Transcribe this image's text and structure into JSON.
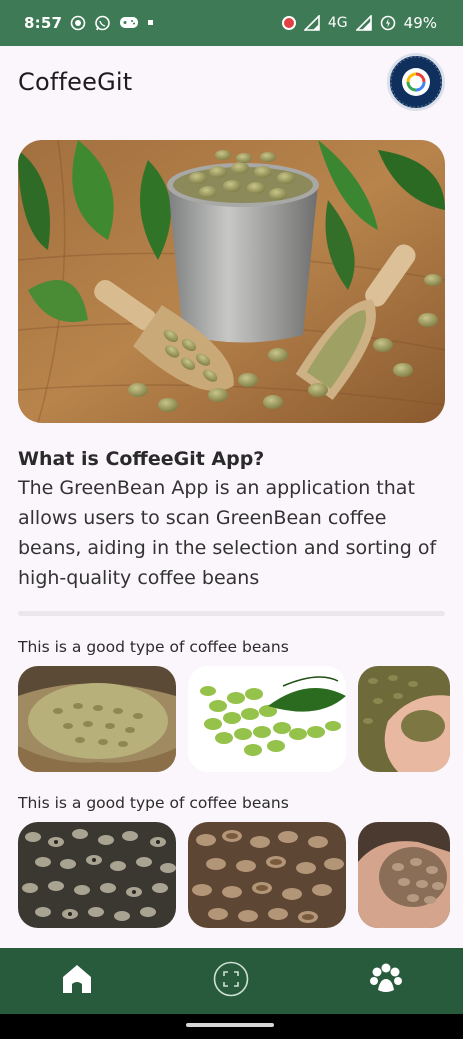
{
  "status_bar": {
    "time": "8:57",
    "network": "4G",
    "battery": "49%"
  },
  "app": {
    "title": "CoffeeGit",
    "avatar_icon": "google-cloud-badge-icon"
  },
  "hero": {
    "image": "green-coffee-beans-bucket-with-scoops"
  },
  "about": {
    "title": "What is CoffeeGit App?",
    "body": "The GreenBean App is an application that allows users to scan GreenBean coffee beans, aiding in the selection and sorting of high-quality coffee beans"
  },
  "sections": [
    {
      "title": "This is a good type of coffee beans",
      "images": [
        "beans-in-burlap-sack",
        "green-beans-with-leaves",
        "beans-in-hands"
      ]
    },
    {
      "title": "This is a good type of coffee beans",
      "images": [
        "dark-spotted-beans",
        "brown-mixed-beans",
        "beans-in-hand"
      ]
    }
  ],
  "nav": {
    "items": [
      "home-icon",
      "scan-icon",
      "paw-icon"
    ]
  },
  "colors": {
    "status_bar": "#3d7a55",
    "nav_bar": "#285a3c",
    "background": "#fbf6fb"
  }
}
